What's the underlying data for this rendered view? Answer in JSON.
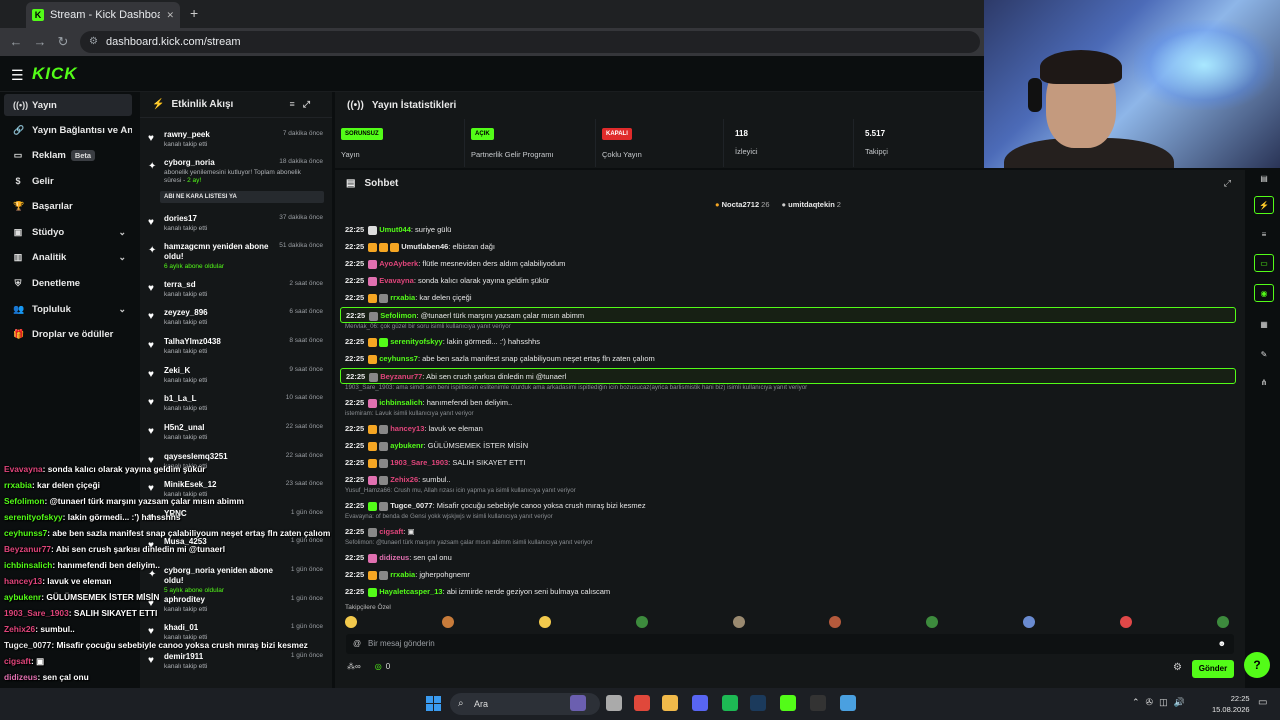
{
  "browser": {
    "tab_title": "Stream - Kick Dashboard",
    "favicon": "K",
    "url": "dashboard.kick.com/stream",
    "new_tab": "+",
    "close": "✕"
  },
  "app": {
    "logo": "KICK",
    "accent": "#53fc18"
  },
  "sidebar": {
    "items": [
      {
        "icon": "broadcast-icon",
        "glyph": "((•))",
        "label": "Yayın"
      },
      {
        "icon": "link-icon",
        "glyph": "🔗",
        "label": "Yayın Bağlantısı ve Anahtarı"
      },
      {
        "icon": "ad-icon",
        "glyph": "▭",
        "label": "Reklam",
        "badge": "Beta"
      },
      {
        "icon": "revenue-icon",
        "glyph": "$",
        "label": "Gelir"
      },
      {
        "icon": "trophy-icon",
        "glyph": "🏆",
        "label": "Başarılar"
      },
      {
        "icon": "studio-icon",
        "glyph": "▣",
        "label": "Stüdyo"
      },
      {
        "icon": "analytics-icon",
        "glyph": "▥",
        "label": "Analitik"
      },
      {
        "icon": "moderation-icon",
        "glyph": "⛨",
        "label": "Denetleme"
      },
      {
        "icon": "community-icon",
        "glyph": "👥",
        "label": "Topluluk"
      },
      {
        "icon": "drops-icon",
        "glyph": "🎁",
        "label": "Droplar ve ödüller"
      }
    ]
  },
  "activity": {
    "title": "Etkinlik Akışı",
    "events": [
      {
        "name": "rawny_peek",
        "sub": "kanalı takip etti",
        "time": "7 dakika önce"
      },
      {
        "name": "cyborg_noria",
        "sub": "abonelik yenilemesini kutluyor! Toplam abonelik süresi - ",
        "sub_gold": "2 ay!",
        "time": "18 dakika önce",
        "reply": "ABI NE KARA LISTESI YA"
      },
      {
        "name": "dories17",
        "sub": "kanalı takip etti",
        "time": "37 dakika önce"
      },
      {
        "name": "hamzagcmn yeniden abone oldu!",
        "sub_gold": "6 aylık abone oldular",
        "time": "51 dakika önce"
      },
      {
        "name": "terra_sd",
        "sub": "kanalı takip etti",
        "time": "2 saat önce"
      },
      {
        "name": "zeyzey_896",
        "sub": "kanalı takip etti",
        "time": "6 saat önce"
      },
      {
        "name": "TalhaYlmz0438",
        "sub": "kanalı takip etti",
        "time": "8 saat önce"
      },
      {
        "name": "Zeki_K",
        "sub": "kanalı takip etti",
        "time": "9 saat önce"
      },
      {
        "name": "b1_La_L",
        "sub": "kanalı takip etti",
        "time": "10 saat önce"
      },
      {
        "name": "H5n2_unal",
        "sub": "kanalı takip etti",
        "time": "22 saat önce"
      },
      {
        "name": "qayseslemq3251",
        "sub": "kanalı takip etti",
        "time": "22 saat önce"
      },
      {
        "name": "MinikEsek_12",
        "sub": "kanalı takip etti",
        "time": "23 saat önce"
      },
      {
        "name": "YRNC",
        "sub": "",
        "time": "1 gün önce"
      },
      {
        "name": "Musa_4253",
        "sub": "",
        "time": "1 gün önce"
      },
      {
        "name": "cyborg_noria yeniden abone oldu!",
        "sub_gold": "5 aylık abone oldular",
        "time": "1 gün önce"
      },
      {
        "name": "aphroditey",
        "sub": "kanalı takip etti",
        "time": "1 gün önce"
      },
      {
        "name": "khadi_01",
        "sub": "kanalı takip etti",
        "time": "1 gün önce"
      },
      {
        "name": "demir1911",
        "sub": "kanalı takip etti",
        "time": "1 gün önce"
      }
    ]
  },
  "stats": {
    "title": "Yayın İstatistikleri",
    "cards": [
      {
        "pill": "SORUNSUZ",
        "pill_bg": "#53fc18",
        "label": "Yayın"
      },
      {
        "pill": "AÇIK",
        "pill_bg": "#53fc18",
        "label": "Partnerlik Gelir Programı"
      },
      {
        "pill": "KAPALI",
        "pill_bg": "#e02b2b",
        "label": "Çoklu Yayın"
      },
      {
        "value": "118",
        "label": "İzleyici"
      },
      {
        "value": "5.517",
        "label": "Takipçi"
      }
    ]
  },
  "chat": {
    "title": "Sohbet",
    "pinned": [
      {
        "name": "Nocta2712",
        "count": "26",
        "color": "#f5a623"
      },
      {
        "name": "umitdaqtekin",
        "count": "2",
        "color": "#cccccc"
      }
    ],
    "lines": [
      {
        "time": "22:25",
        "user": "Umut044",
        "color": "#53fc18",
        "text": "suriye gülü",
        "badges": [
          "#ddd"
        ]
      },
      {
        "time": "22:25",
        "user": "Umutlaben46",
        "color": "#e8e8e8",
        "text": "elbistan dağı",
        "badges": [
          "#f5a623",
          "#f5a623",
          "#f5a623"
        ]
      },
      {
        "time": "22:25",
        "user": "AyoAyberk",
        "color": "#e0457b",
        "text": "flütle mesneviden ders aldım çalabiliyodum",
        "badges": [
          "#e070b0"
        ]
      },
      {
        "time": "22:25",
        "user": "Evavayna",
        "color": "#e0457b",
        "text": "sonda kalıcı olarak yayına geldim şükür",
        "badges": [
          "#e070b0"
        ]
      },
      {
        "time": "22:25",
        "user": "rrxabia",
        "color": "#53fc18",
        "text": "kar delen çiçeği",
        "badges": [
          "#f5a623",
          "#888"
        ]
      },
      {
        "time": "22:25",
        "user": "Sefolimon",
        "color": "#53fc18",
        "text": "@tunaerl türk marşını yazsam çalar mısın abimm",
        "badges": [
          "#888"
        ],
        "highlight": true
      },
      {
        "time": "22:25",
        "user": "serenityofskyy",
        "color": "#53fc18",
        "text": "lakin görmedi... :') hahsshhs",
        "badges": [
          "#f5a623",
          "#53fc18"
        ],
        "context": "Mervlak_06: çok güzel bir soru isimli kullanıcıya yanıt veriyor"
      },
      {
        "time": "22:25",
        "user": "ceyhunss7",
        "color": "#53fc18",
        "text": "abe ben sazla manifest snap çalabiliyoum neşet ertaş fln zaten çalıom",
        "badges": [
          "#f5a623"
        ]
      },
      {
        "time": "22:25",
        "user": "Beyzanur77",
        "color": "#e0457b",
        "text": "Abi sen crush şarkısı dinledin mi @tunaerl",
        "badges": [
          "#888"
        ],
        "highlight": true
      },
      {
        "time": "22:25",
        "user": "ichbinsalich",
        "color": "#53fc18",
        "text": "hanımefendi ben deliyim..",
        "badges": [
          "#e070b0"
        ],
        "context": "1903_Sare_1903: ama simdi sen beni ispiitlesen eslitenimle olurduk ama arkadasimi ispitlediğin icin bozusucaz(ayrica barlismistik hani biz) isimli kullanıcıya yanıt veriyor"
      },
      {
        "time": "22:25",
        "user": "hancey13",
        "color": "#e0457b",
        "text": "lavuk ve eleman",
        "badges": [
          "#f5a623",
          "#888"
        ],
        "context": "istemiram: Lavuk isimli kullanıcıya yanıt veriyor"
      },
      {
        "time": "22:25",
        "user": "aybukenr",
        "color": "#53fc18",
        "text": "GÜLÜMSEMEK İSTER MİSİN",
        "badges": [
          "#f5a623",
          "#888"
        ]
      },
      {
        "time": "22:25",
        "user": "1903_Sare_1903",
        "color": "#e0457b",
        "text": "SALIH SIKAYET ETTI",
        "badges": [
          "#f5a623",
          "#888"
        ]
      },
      {
        "time": "22:25",
        "user": "Zehix26",
        "color": "#e0457b",
        "text": "sumbul..",
        "badges": [
          "#e070b0",
          "#888"
        ]
      },
      {
        "time": "22:25",
        "user": "Tugce_0077",
        "color": "#e8e8e8",
        "text": "Misafir çocuğu sebebiyle canoo yoksa crush mıraş bizi kesmez",
        "badges": [
          "#53fc18",
          "#888"
        ],
        "context": "Yusuf_Hamza66: Crush mu, Allah rızası icin yapma ya isimli kullanıcıya yanıt veriyor"
      },
      {
        "time": "22:25",
        "user": "cigsaft",
        "color": "#e0457b",
        "text": "▣",
        "badges": [
          "#888"
        ],
        "context": "Evavayna: of benda de Gensi yokk wjskjwjs w isimli kullanıcıya yanıt veriyor"
      },
      {
        "time": "22:25",
        "user": "didizeus",
        "color": "#e070b0",
        "text": "sen çal onu",
        "badges": [
          "#e070b0"
        ],
        "context": "Sefolimon: @tunaerl türk marşını yazsam çalar mısın abimm isimli kullanıcıya yanıt veriyor"
      },
      {
        "time": "22:25",
        "user": "rrxabia",
        "color": "#53fc18",
        "text": "jgherpohgnemr",
        "badges": [
          "#f5a623",
          "#888"
        ]
      },
      {
        "time": "22:25",
        "user": "Hayaletcasper_13",
        "color": "#53fc18",
        "text": "abi izmirde nerde geziyon seni bulmaya calıscam",
        "badges": [
          "#53fc18"
        ]
      }
    ],
    "emotes_label": "Takipçilere Özel",
    "input_placeholder": "Bir mesaj gönderin",
    "points": "0",
    "send": "Gönder"
  },
  "overlay": [
    {
      "user": "Evavayna",
      "color": "#e0457b",
      "text": ": sonda kalıcı olarak yayına geldim şükür"
    },
    {
      "user": "rrxabia",
      "color": "#53fc18",
      "text": ": kar delen çiçeği"
    },
    {
      "user": "Sefolimon",
      "color": "#53fc18",
      "text": ": @tunaerl türk marşını yazsam çalar mısın abimm"
    },
    {
      "user": "serenityofskyy",
      "color": "#53fc18",
      "text": ": lakin görmedi... :') hahsshhs"
    },
    {
      "user": "ceyhunss7",
      "color": "#53fc18",
      "text": ": abe ben sazla manifest snap çalabiliyoum neşet ertaş fln zaten çalıom"
    },
    {
      "user": "Beyzanur77",
      "color": "#e0457b",
      "text": ": Abi sen crush şarkısı dinledin mi @tunaerl"
    },
    {
      "user": "ichbinsalich",
      "color": "#53fc18",
      "text": ": hanımefendi ben deliyim.."
    },
    {
      "user": "hancey13",
      "color": "#e0457b",
      "text": ": lavuk ve eleman"
    },
    {
      "user": "aybukenr",
      "color": "#53fc18",
      "text": ": GÜLÜMSEMEK İSTER MİSİN"
    },
    {
      "user": "1903_Sare_1903",
      "color": "#e0457b",
      "text": ": SALIH SIKAYET ETTI"
    },
    {
      "user": "Zehix26",
      "color": "#e0457b",
      "text": ": sumbul.."
    },
    {
      "user": "Tugce_0077",
      "color": "#e8e8e8",
      "text": ": Misafir çocuğu sebebiyle canoo yoksa crush mıraş bizi kesmez"
    },
    {
      "user": "cigsaft",
      "color": "#e0457b",
      "text": ": ▣"
    },
    {
      "user": "didizeus",
      "color": "#e070b0",
      "text": ": sen çal onu"
    },
    {
      "user": "rrxabia",
      "color": "#53fc18",
      "text": ": jgherpohgnemr"
    },
    {
      "user": "Hayaletcasper_13",
      "color": "#53fc18",
      "text": ": abi izmirde nerde geziyon seni bulmaya calıscam"
    }
  ],
  "taskbar": {
    "search": "Ara",
    "time": "22:25",
    "date": "15.08.2026"
  }
}
